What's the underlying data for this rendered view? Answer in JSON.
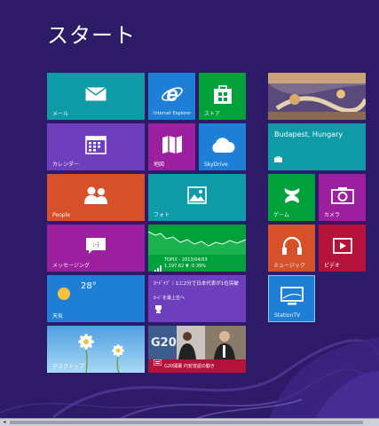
{
  "screen": {
    "title": "スタート"
  },
  "tiles": {
    "mail": {
      "label": "メール",
      "color": "#0e9aa7"
    },
    "ie": {
      "label": "Internet Explorer",
      "color": "#1f7fd6"
    },
    "store": {
      "label": "ストア",
      "color": "#00a13a"
    },
    "calendar": {
      "label": "カレンダー",
      "color": "#6e3fbc"
    },
    "maps": {
      "label": "地図",
      "color": "#9b1f9f"
    },
    "skydrive": {
      "label": "SkyDrive",
      "color": "#1f7fd6"
    },
    "people": {
      "label": "People",
      "color": "#d6502a"
    },
    "photos": {
      "label": "フォト",
      "color": "#0e9aa7"
    },
    "messaging": {
      "label": "メッセージング",
      "color": "#9b1f9f"
    },
    "finance": {
      "label": "TOPIX - 2013/04/03",
      "sub": "1,197.62 ▼ -0.39%",
      "color": "#00a13a"
    },
    "weather": {
      "label": "天気",
      "temp": "28°",
      "color": "#1f7fd6"
    },
    "sports": {
      "headline": "ｶｰﾄﾞｲﾌﾞ｜1ｺﾆ2分で日本代表が1位突破",
      "sub": "ｶｰﾄﾞを最上位へ",
      "color": "#6e3fbc"
    },
    "desktop": {
      "label": "デスクトップ"
    },
    "news": {
      "headline": "G20開幕 円安容認の動き",
      "sub": "G20",
      "color": "#b5123b"
    },
    "travel": {
      "headline": "Budapest, Hungary",
      "color": "#0e9aa7"
    },
    "games": {
      "label": "ゲーム",
      "color": "#00a13a"
    },
    "camera": {
      "label": "カメラ",
      "color": "#9b1f9f"
    },
    "music": {
      "label": "ミュージック",
      "color": "#d6502a"
    },
    "video": {
      "label": "ビデオ",
      "color": "#b5123b"
    },
    "tv": {
      "label": "StationTV",
      "color": "#1f7fd6"
    }
  },
  "scrollbar": {
    "arrow": "◂"
  }
}
